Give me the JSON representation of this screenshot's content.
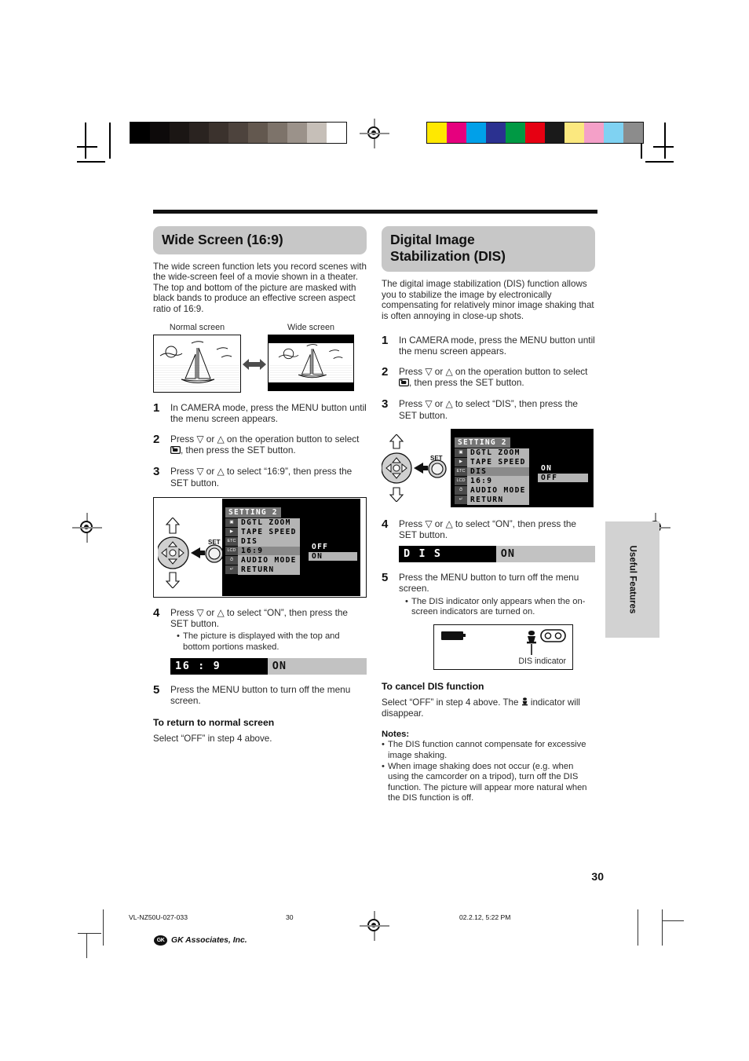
{
  "page_number": "30",
  "side_tab": "Useful Features",
  "left_column": {
    "heading": "Wide Screen (16:9)",
    "intro": "The wide screen function lets you record scenes with the wide-screen feel of a movie shown in a theater. The top and bottom of the picture are masked with black bands to produce an effective screen aspect ratio of 16:9.",
    "figure": {
      "normal_caption": "Normal screen",
      "wide_caption": "Wide screen"
    },
    "steps": [
      {
        "num": "1",
        "text": "In CAMERA mode, press the MENU button until the menu screen appears."
      },
      {
        "num": "2",
        "text_before": "Press ▽ or △ on the operation button to select ",
        "text_after": ", then press the SET button."
      },
      {
        "num": "3",
        "text": "Press ▽ or △ to select “16:9”, then press the SET button."
      },
      {
        "num": "4",
        "text": "Press ▽ or △ to select “ON”, then press the SET button.",
        "bullet": "The picture is displayed with the top and bottom portions masked."
      },
      {
        "num": "5",
        "text": "Press the MENU button to turn off the menu screen."
      }
    ],
    "osd": {
      "title": "SETTING 2",
      "icons": [
        "CAM",
        "PB",
        "ETC",
        "LCD",
        "CLK",
        "RET"
      ],
      "items": [
        "DGTL ZOOM",
        "TAPE SPEED",
        "DIS",
        "16:9",
        "AUDIO MODE",
        "RETURN"
      ],
      "selected_item": "16:9",
      "options": [
        "OFF",
        "ON"
      ],
      "highlighted_option": "OFF",
      "set_label": "SET"
    },
    "status_bar": {
      "label": "16 : 9",
      "value": "ON"
    },
    "sub_heading": "To return to normal screen",
    "sub_text": "Select “OFF” in step 4 above."
  },
  "right_column": {
    "heading_line1": "Digital Image",
    "heading_line2": "Stabilization (DIS)",
    "intro": "The digital image stabilization (DIS) function allows you to stabilize the image by electronically compensating for relatively minor image shaking that is often annoying in close-up shots.",
    "steps": [
      {
        "num": "1",
        "text": "In CAMERA mode, press the MENU button until the menu screen appears."
      },
      {
        "num": "2",
        "text_before": "Press ▽ or △ on the operation button to select ",
        "text_after": ", then press the SET button."
      },
      {
        "num": "3",
        "text": "Press ▽ or △ to select “DIS”, then press the SET button."
      },
      {
        "num": "4",
        "text": "Press ▽ or △ to select “ON”, then press the SET button."
      },
      {
        "num": "5",
        "text": "Press the MENU button to turn off the menu screen.",
        "bullet": "The DIS indicator only appears when the on-screen indicators are turned on."
      }
    ],
    "osd": {
      "title": "SETTING 2",
      "icons": [
        "CAM",
        "PB",
        "ETC",
        "LCD",
        "CLK",
        "RET"
      ],
      "items": [
        "DGTL ZOOM",
        "TAPE SPEED",
        "DIS",
        "16:9",
        "AUDIO MODE",
        "RETURN"
      ],
      "selected_item": "DIS",
      "options": [
        "ON",
        "OFF"
      ],
      "highlighted_option": "ON",
      "set_label": "SET"
    },
    "status_bar": {
      "label": "D I S",
      "value": "ON"
    },
    "indicator_figure": {
      "caption": "DIS indicator"
    },
    "cancel_heading": "To cancel DIS function",
    "cancel_text_before": "Select “OFF” in step 4 above. The ",
    "cancel_text_after": " indicator will disappear.",
    "notes_title": "Notes:",
    "notes": [
      "The DIS function cannot compensate for excessive image shaking.",
      "When image shaking does not occur (e.g. when using the camcorder on a tripod), turn off the DIS function. The picture will appear more natural when the DIS function is off."
    ]
  },
  "footer": {
    "doc_id": "VL-NZ50U-027-033",
    "page": "30",
    "timestamp": "02.2.12, 5:22 PM",
    "company": "GK Associates, Inc.",
    "company_mark": "GK"
  },
  "swatches": {
    "gray": [
      "#000000",
      "#0d0a0a",
      "#1b1614",
      "#2a2320",
      "#3b322d",
      "#4d433d",
      "#63584f",
      "#7d736a",
      "#9b928a",
      "#c6bfb8",
      "#ffffff"
    ],
    "color": [
      "#ffe800",
      "#e6007e",
      "#00a0e9",
      "#2b3190",
      "#009944",
      "#e60012",
      "#1a1a1a",
      "#fbe87f",
      "#f4a0c8",
      "#7fd2f2",
      "#8c8c8c"
    ]
  }
}
